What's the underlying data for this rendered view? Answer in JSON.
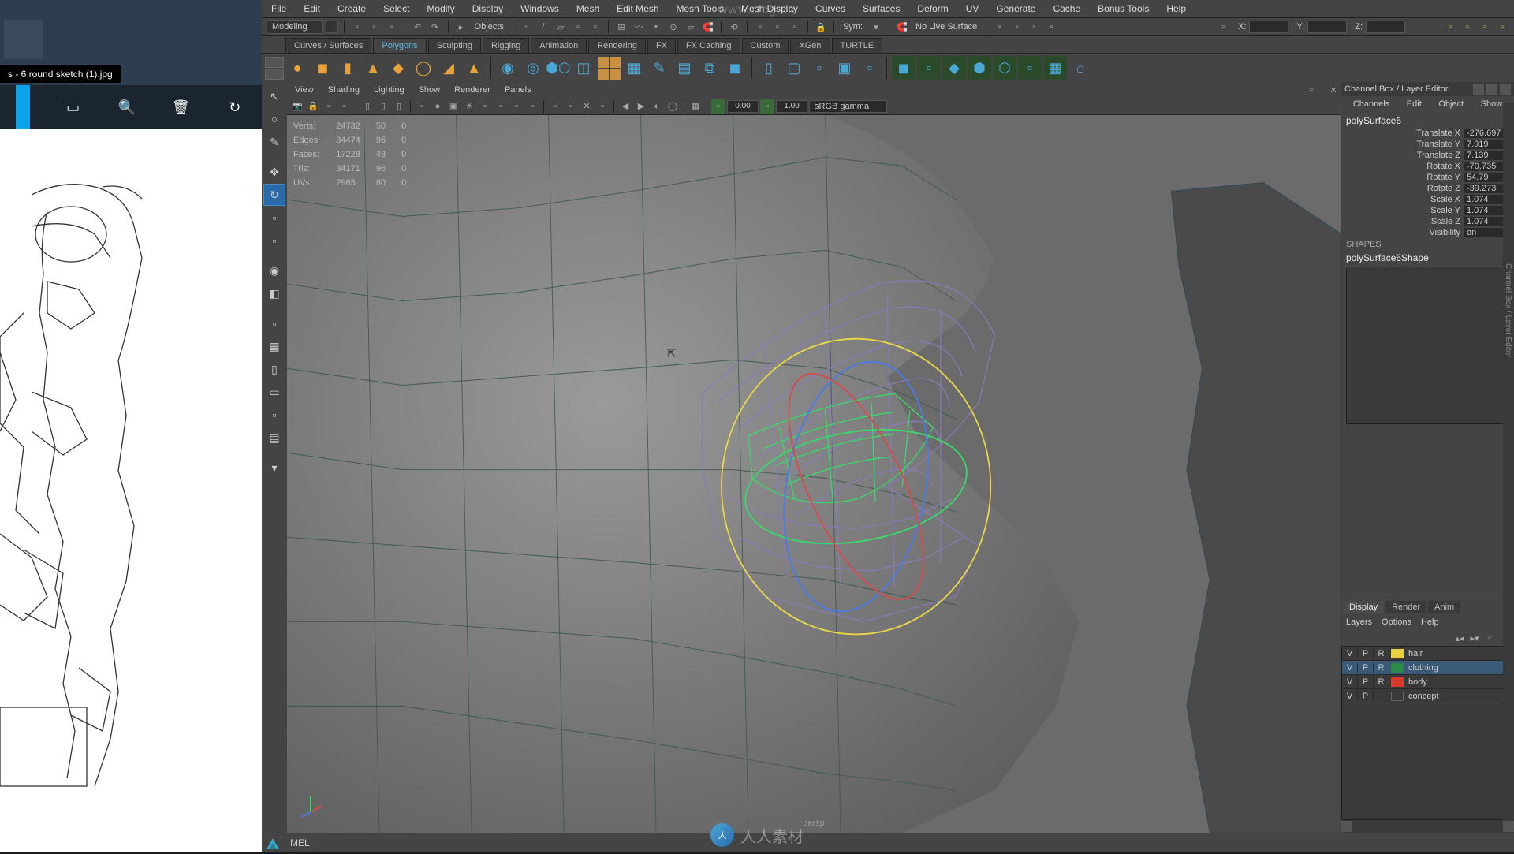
{
  "watermark_top": "www.rrcg.cn",
  "left_ref": {
    "tab_title": "s - 6 round sketch (1).jpg",
    "icons": [
      "chat",
      "search",
      "trash",
      "refresh"
    ]
  },
  "menubar": [
    "File",
    "Edit",
    "Create",
    "Select",
    "Modify",
    "Display",
    "Windows",
    "Mesh",
    "Edit Mesh",
    "Mesh Tools",
    "Mesh Display",
    "Curves",
    "Surfaces",
    "Deform",
    "UV",
    "Generate",
    "Cache",
    "Bonus Tools",
    "Help"
  ],
  "status_line": {
    "workspace": "Modeling",
    "objects_label": "Objects",
    "sym_label": "Sym:",
    "no_live_surf": "No Live Surface",
    "x_label": "X:",
    "y_label": "Y:",
    "z_label": "Z:"
  },
  "shelf_tabs": [
    "Curves / Surfaces",
    "Polygons",
    "Sculpting",
    "Rigging",
    "Animation",
    "Rendering",
    "FX",
    "FX Caching",
    "Custom",
    "XGen",
    "TURTLE"
  ],
  "shelf_active_index": 1,
  "panel_menus": [
    "View",
    "Shading",
    "Lighting",
    "Show",
    "Renderer",
    "Panels"
  ],
  "panel_toolbar": {
    "gamma_in": "0.00",
    "gamma_out": "1.00",
    "color_space": "sRGB gamma"
  },
  "hud": {
    "rows": [
      [
        "Verts:",
        "24732",
        "50",
        "0"
      ],
      [
        "Edges:",
        "34474",
        "96",
        "0"
      ],
      [
        "Faces:",
        "17228",
        "48",
        "0"
      ],
      [
        "Tris:",
        "34171",
        "96",
        "0"
      ],
      [
        "UVs:",
        "2965",
        "80",
        "0"
      ]
    ]
  },
  "viewport_camera": "persp",
  "channel_box": {
    "title": "Channel Box / Layer Editor",
    "menus": [
      "Channels",
      "Edit",
      "Object",
      "Show"
    ],
    "object": "polySurface6",
    "attrs": [
      {
        "label": "Translate X",
        "value": "-276.697"
      },
      {
        "label": "Translate Y",
        "value": "7.919"
      },
      {
        "label": "Translate Z",
        "value": "7.139"
      },
      {
        "label": "Rotate X",
        "value": "-70.735"
      },
      {
        "label": "Rotate Y",
        "value": "54.79"
      },
      {
        "label": "Rotate Z",
        "value": "-39.273"
      },
      {
        "label": "Scale X",
        "value": "1.074"
      },
      {
        "label": "Scale Y",
        "value": "1.074"
      },
      {
        "label": "Scale Z",
        "value": "1.074"
      },
      {
        "label": "Visibility",
        "value": "on"
      }
    ],
    "shapes_label": "SHAPES",
    "shape_name": "polySurface6Shape"
  },
  "layer_panel": {
    "tabs": [
      "Display",
      "Render",
      "Anim"
    ],
    "active_tab": 0,
    "menus": [
      "Layers",
      "Options",
      "Help"
    ],
    "layers": [
      {
        "v": "V",
        "p": "P",
        "r": "R",
        "color": "#e8d040",
        "name": "hair",
        "selected": false
      },
      {
        "v": "V",
        "p": "P",
        "r": "R",
        "color": "#2a8a4a",
        "name": "clothing",
        "selected": true
      },
      {
        "v": "V",
        "p": "P",
        "r": "R",
        "color": "#d83a2a",
        "name": "body",
        "selected": false
      },
      {
        "v": "V",
        "p": "P",
        "r": "",
        "color": "transparent",
        "name": "concept",
        "selected": false
      }
    ]
  },
  "command_line": "MEL",
  "side_label": "Channel Box / Layer Editor"
}
